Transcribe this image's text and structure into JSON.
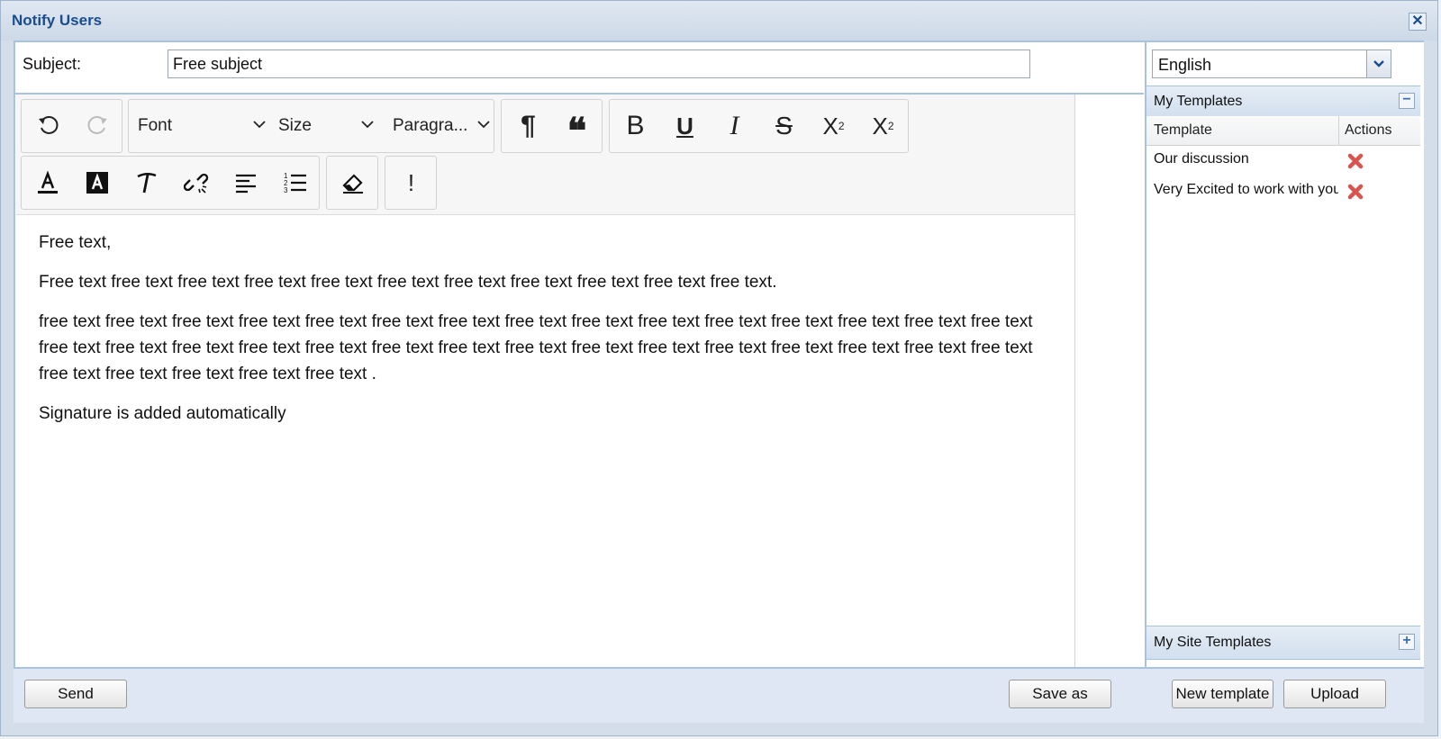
{
  "dialog": {
    "title": "Notify Users",
    "close_label": "✕"
  },
  "subject": {
    "label": "Subject:",
    "value": "Free subject"
  },
  "toolbar": {
    "undo_icon": "undo-icon",
    "redo_icon": "redo-icon",
    "font_label": "Font",
    "size_label": "Size",
    "format_label": "Paragra...",
    "paragraph_glyph": "¶",
    "quote_glyph": "❝",
    "bold_glyph": "B",
    "underline_glyph": "U",
    "italic_glyph": "I",
    "strike_glyph": "S",
    "subscript_glyph": "X",
    "subscript_small": "2",
    "superscript_glyph": "X",
    "superscript_small": "2",
    "bang_glyph": "!"
  },
  "editor": {
    "paragraphs": [
      "Free text,",
      "Free text free text free text free text free text free text free text free text free text free text free text.",
      "free text free text free text free text free text free text free text free text free text free text free text free text free text free text free text free text free text free text free text free text free text free text free text free text free text free text free text free text free text free text free text free text free text free text free text .",
      "Signature is added automatically"
    ]
  },
  "language": {
    "value": "English"
  },
  "my_templates": {
    "title": "My Templates",
    "collapse_label": "−",
    "columns": {
      "template": "Template",
      "actions": "Actions"
    },
    "rows": [
      {
        "name": "Our discussion"
      },
      {
        "name": "Very Excited to work with you"
      }
    ]
  },
  "my_site_templates": {
    "title": "My Site Templates",
    "expand_label": "+"
  },
  "buttons": {
    "send": "Send",
    "save_as": "Save as",
    "new_template": "New template",
    "upload": "Upload"
  },
  "colors": {
    "title_text": "#1a4d8f",
    "panel_border": "#a9c2e0",
    "delete_icon": "#d9534f"
  }
}
